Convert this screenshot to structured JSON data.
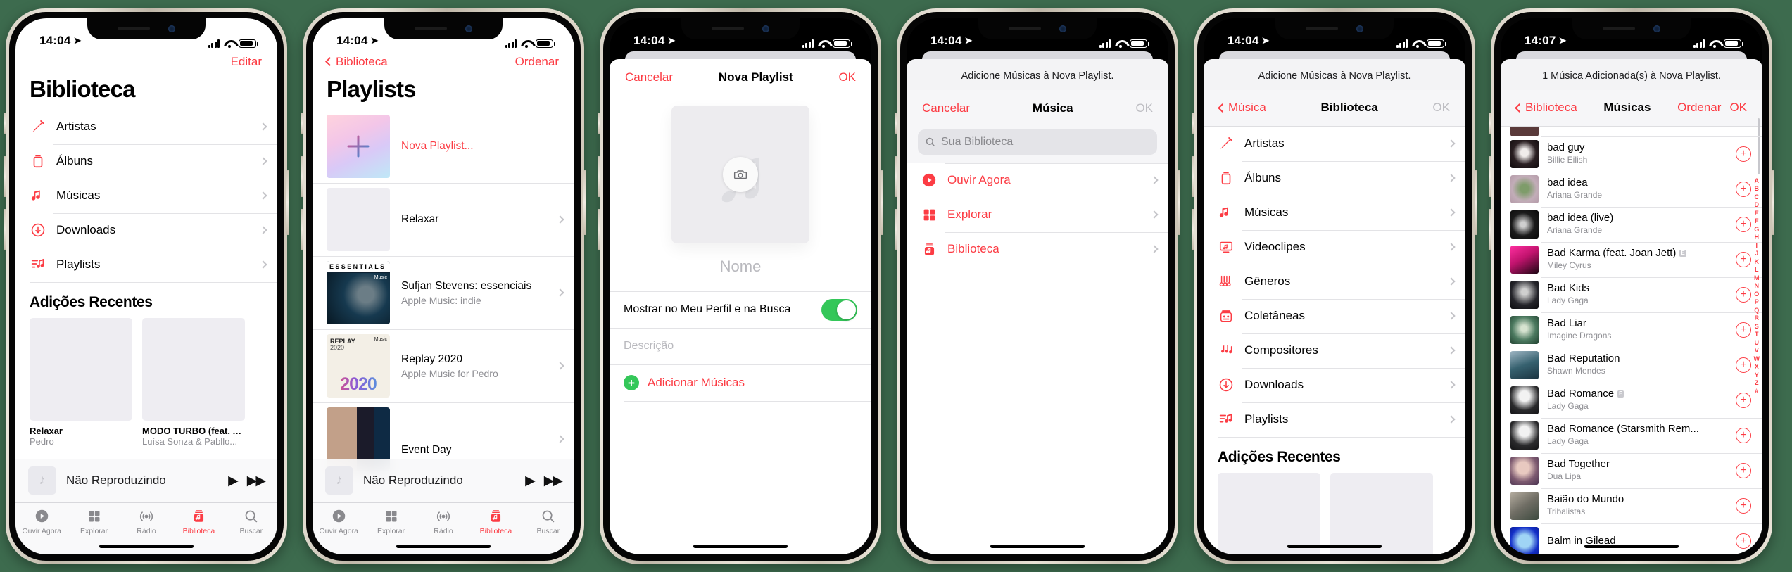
{
  "accent": "#fc3c44",
  "green": "#34c759",
  "background": "#3d6b4e",
  "phones": [
    {
      "id": "library",
      "status": {
        "time": "14:04",
        "location_icon": "location-arrow-icon"
      },
      "nav": {
        "right_label": "Editar"
      },
      "title": "Biblioteca",
      "rows": [
        {
          "icon": "microphone-icon",
          "label": "Artistas"
        },
        {
          "icon": "albums-icon",
          "label": "Álbuns"
        },
        {
          "icon": "music-note-icon",
          "label": "Músicas"
        },
        {
          "icon": "download-circle-icon",
          "label": "Downloads"
        },
        {
          "icon": "playlist-icon",
          "label": "Playlists"
        }
      ],
      "section_header": "Adições Recentes",
      "recents": [
        {
          "title": "Relaxar",
          "subtitle": "Pedro",
          "art": "plain"
        },
        {
          "title": "MODO TURBO (feat. A...",
          "subtitle": "Luísa Sonza & Pabllo...",
          "art": "modo"
        }
      ],
      "miniplayer": {
        "title": "Não Reproduzindo",
        "play": "▶",
        "next": "▶▶"
      },
      "tabs": [
        {
          "label": "Ouvir Agora",
          "icon": "play-circle-icon",
          "active": false
        },
        {
          "label": "Explorar",
          "icon": "grid-icon",
          "active": false
        },
        {
          "label": "Rádio",
          "icon": "radio-waves-icon",
          "active": false
        },
        {
          "label": "Biblioteca",
          "icon": "library-icon",
          "active": true
        },
        {
          "label": "Buscar",
          "icon": "search-icon",
          "active": false
        }
      ]
    },
    {
      "id": "playlists",
      "status": {
        "time": "14:04"
      },
      "nav": {
        "back_label": "Biblioteca",
        "right_label": "Ordenar"
      },
      "title": "Playlists",
      "items": [
        {
          "title": "Nova Playlist...",
          "subtitle": "",
          "art": "new",
          "accent": true,
          "chevron": false
        },
        {
          "title": "Relaxar",
          "subtitle": "",
          "art": "plain",
          "accent": false,
          "chevron": true
        },
        {
          "title": "Sufjan Stevens: essenciais",
          "subtitle": "Apple Music: indie",
          "art": "essentials",
          "accent": false,
          "chevron": true
        },
        {
          "title": "Replay 2020",
          "subtitle": "Apple Music for Pedro",
          "art": "replay",
          "accent": false,
          "chevron": true
        },
        {
          "title": "Event Day",
          "subtitle": "",
          "art": "event",
          "accent": false,
          "chevron": true
        }
      ],
      "art_labels": {
        "essentials": "ESSENTIALS",
        "essentials_badge": "Music",
        "replay_line1": "REPLAY",
        "replay_line2": "2020",
        "replay_big": "2020",
        "replay_badge": "Music"
      },
      "miniplayer": {
        "title": "Não Reproduzindo",
        "play": "▶",
        "next": "▶▶"
      },
      "tabs": [
        {
          "label": "Ouvir Agora",
          "icon": "play-circle-icon",
          "active": false
        },
        {
          "label": "Explorar",
          "icon": "grid-icon",
          "active": false
        },
        {
          "label": "Rádio",
          "icon": "radio-waves-icon",
          "active": false
        },
        {
          "label": "Biblioteca",
          "icon": "library-icon",
          "active": true
        },
        {
          "label": "Buscar",
          "icon": "search-icon",
          "active": false
        }
      ]
    },
    {
      "id": "new-playlist",
      "status": {
        "time": "14:04"
      },
      "sheet": {
        "cancel": "Cancelar",
        "title": "Nova Playlist",
        "ok": "OK",
        "artwork_icon": "music-note-placeholder-icon",
        "camera_icon": "camera-icon",
        "name_placeholder": "Nome",
        "toggle_label": "Mostrar no Meu Perfil e na Busca",
        "toggle_on": true,
        "description_placeholder": "Descrição",
        "add_songs_label": "Adicionar Músicas"
      }
    },
    {
      "id": "add-music-root",
      "status": {
        "time": "14:04"
      },
      "sheet": {
        "note": "Adicione Músicas à Nova Playlist.",
        "cancel": "Cancelar",
        "title": "Música",
        "ok": "OK",
        "search_placeholder": "Sua Biblioteca",
        "rows": [
          {
            "icon": "play-circle-icon",
            "label": "Ouvir Agora"
          },
          {
            "icon": "grid-icon",
            "label": "Explorar"
          },
          {
            "icon": "library-icon",
            "label": "Biblioteca"
          }
        ]
      }
    },
    {
      "id": "add-music-library",
      "status": {
        "time": "14:04"
      },
      "sheet": {
        "note": "Adicione Músicas à Nova Playlist.",
        "back_label": "Música",
        "title": "Biblioteca",
        "ok": "OK",
        "rows": [
          {
            "icon": "microphone-icon",
            "label": "Artistas"
          },
          {
            "icon": "albums-icon",
            "label": "Álbuns"
          },
          {
            "icon": "music-note-icon",
            "label": "Músicas"
          },
          {
            "icon": "videoclip-icon",
            "label": "Videoclipes"
          },
          {
            "icon": "genres-icon",
            "label": "Gêneros"
          },
          {
            "icon": "compilations-icon",
            "label": "Coletâneas"
          },
          {
            "icon": "composers-icon",
            "label": "Compositores"
          },
          {
            "icon": "download-circle-icon",
            "label": "Downloads"
          },
          {
            "icon": "playlist-icon",
            "label": "Playlists"
          }
        ],
        "section_header": "Adições Recentes",
        "recents": [
          {
            "art": "plain"
          },
          {
            "art": "modo"
          }
        ]
      }
    },
    {
      "id": "songs-list",
      "status": {
        "time": "14:07"
      },
      "sheet": {
        "note": "1 Música Adicionada(s) à Nova Playlist.",
        "back_label": "Biblioteca",
        "title": "Músicas",
        "sort": "Ordenar",
        "ok": "OK",
        "songs": [
          {
            "name": "bad guy",
            "artist": "Billie Eilish",
            "explicit": false,
            "art": "#1c1417"
          },
          {
            "name": "bad idea",
            "artist": "Ariana Grande",
            "explicit": false,
            "art": "#b49aa8"
          },
          {
            "name": "bad idea (live)",
            "artist": "Ariana Grande",
            "explicit": false,
            "art": "#141414"
          },
          {
            "name": "Bad Karma (feat. Joan Jett)",
            "artist": "Miley Cyrus",
            "explicit": true,
            "art": "#d0197a"
          },
          {
            "name": "Bad Kids",
            "artist": "Lady Gaga",
            "explicit": false,
            "art": "#1a1a1c"
          },
          {
            "name": "Bad Liar",
            "artist": "Imagine Dragons",
            "explicit": false,
            "art": "#3f6a57"
          },
          {
            "name": "Bad Reputation",
            "artist": "Shawn Mendes",
            "explicit": false,
            "art": "#2a4d63"
          },
          {
            "name": "Bad Romance",
            "artist": "Lady Gaga",
            "explicit": true,
            "art": "#202022"
          },
          {
            "name": "Bad Romance (Starsmith Rem...",
            "artist": "Lady Gaga",
            "explicit": false,
            "art": "#202022"
          },
          {
            "name": "Bad Together",
            "artist": "Dua Lipa",
            "explicit": false,
            "art": "#8c6f80"
          },
          {
            "name": "Baião do Mundo",
            "artist": "Tribalistas",
            "explicit": false,
            "art": "#7f7d74"
          },
          {
            "name": "Balm in Gilead",
            "artist": "",
            "explicit": false,
            "art": "#1c3fd0"
          }
        ],
        "alphabet": [
          "A",
          "B",
          "C",
          "D",
          "E",
          "F",
          "G",
          "H",
          "I",
          "J",
          "K",
          "L",
          "M",
          "N",
          "O",
          "P",
          "Q",
          "R",
          "S",
          "T",
          "U",
          "V",
          "W",
          "X",
          "Y",
          "Z",
          "#"
        ],
        "add_icon": "plus-circle-icon"
      }
    }
  ]
}
